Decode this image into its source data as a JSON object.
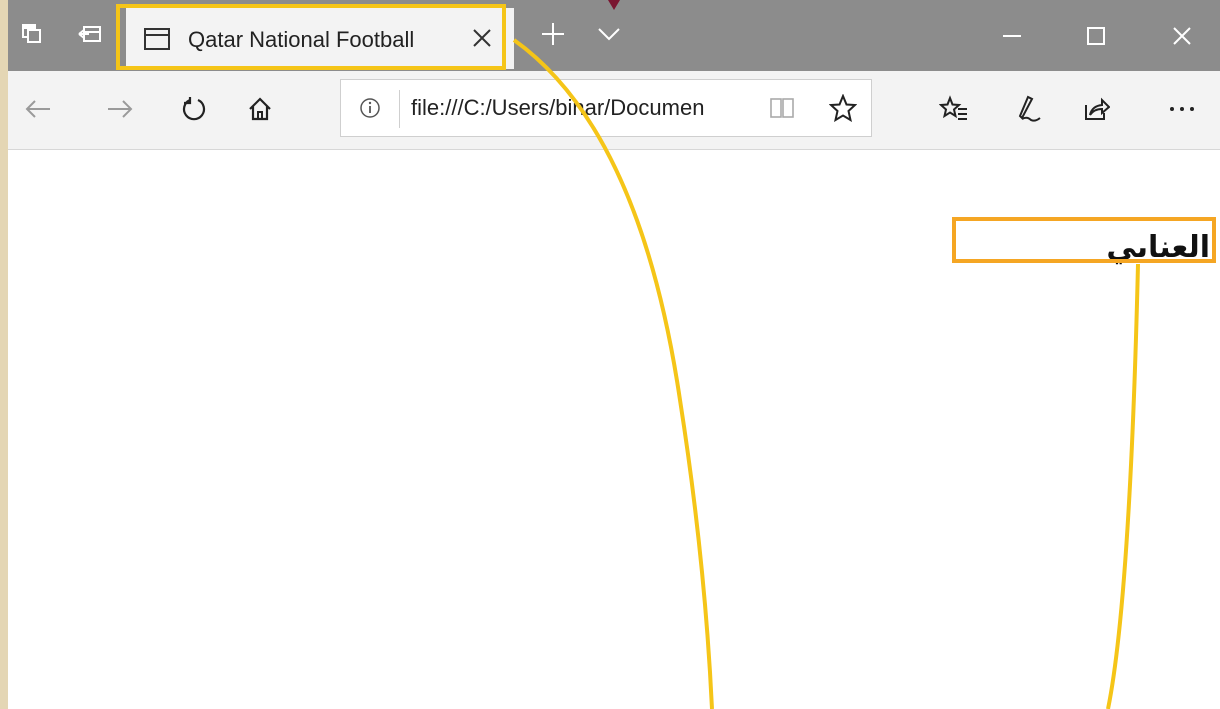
{
  "tab": {
    "title": "Qatar National Football"
  },
  "address_bar": {
    "url": "file:///C:/Users/binar/Documen"
  },
  "page": {
    "heading": "العنابي"
  },
  "icons": {
    "tab_actions": "set-aside-tabs-icon",
    "tab_preview": "tab-preview-icon",
    "page": "page-icon",
    "close_tab": "close-icon",
    "new_tab": "plus-icon",
    "tab_list": "chevron-down-icon",
    "minimize": "minimize-icon",
    "maximize": "maximize-icon",
    "close_window": "close-icon",
    "back": "back-arrow-icon",
    "forward": "forward-arrow-icon",
    "refresh": "refresh-icon",
    "home": "home-icon",
    "info": "info-icon",
    "reading_view": "book-icon",
    "favorite": "star-icon",
    "favorites_hub": "favorites-list-icon",
    "notes": "pen-icon",
    "share": "share-icon",
    "more": "more-icon"
  },
  "colors": {
    "titlebar": "#8c8c8c",
    "tab_highlight": "#f5c518",
    "heading_highlight": "#f5a623",
    "callout_line": "#f5c518"
  }
}
